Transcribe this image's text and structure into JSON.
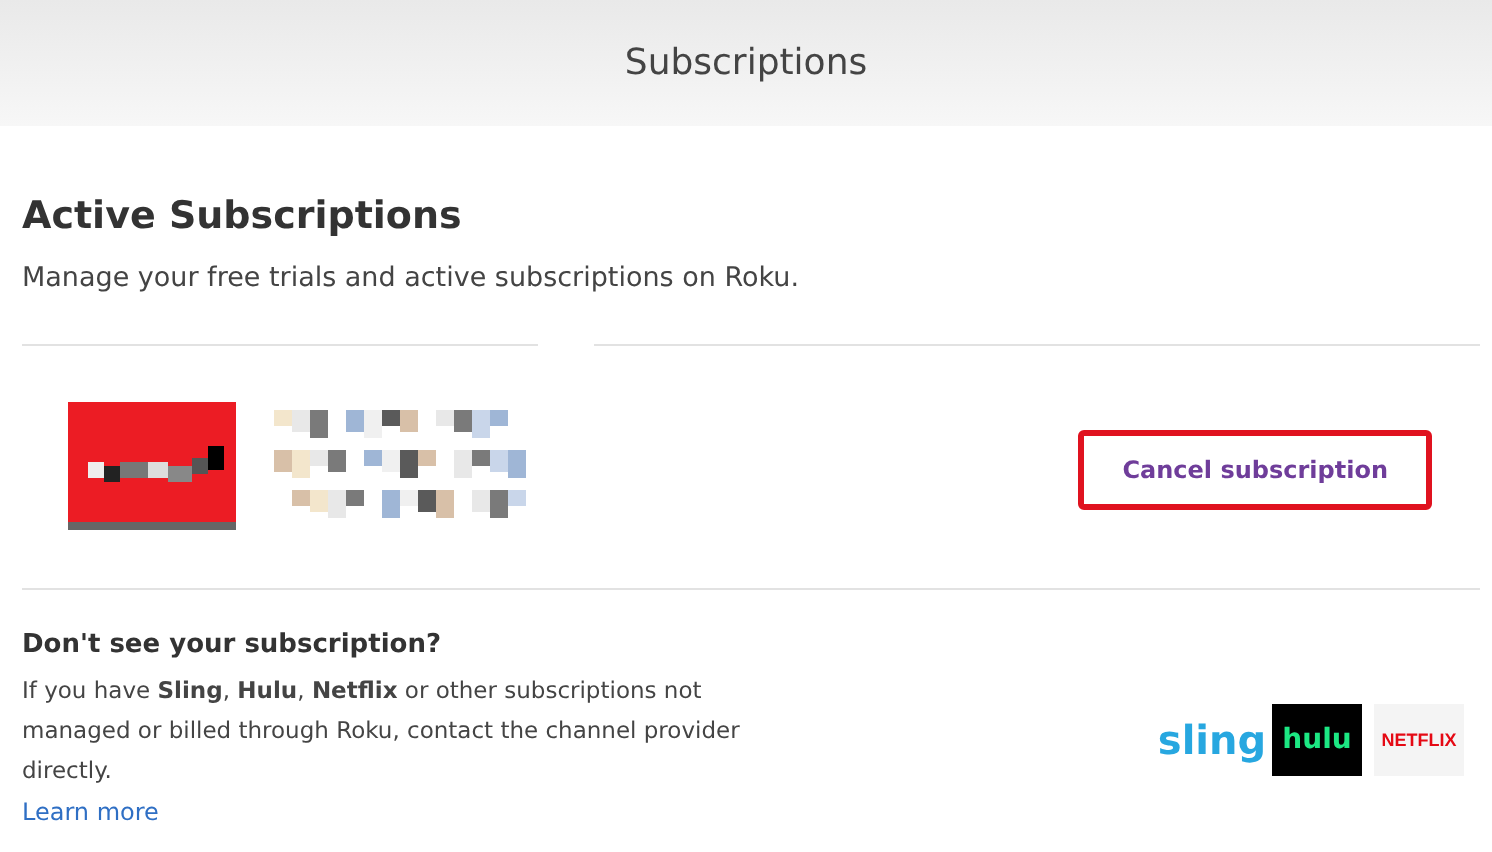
{
  "header": {
    "title": "Subscriptions"
  },
  "section": {
    "heading": "Active Subscriptions",
    "description": "Manage your free trials and active subscriptions on Roku."
  },
  "subscription": {
    "cancel_button": {
      "label": "Cancel subscription",
      "highlighted": true
    }
  },
  "help": {
    "heading": "Don't see your subscription?",
    "text": "If you have **Sling**, **Hulu**, **Netflix** or other subscriptions not managed or billed through Roku, contact the channel provider directly.",
    "link": "Learn more",
    "logos": [
      {
        "kind": "sling",
        "label": "sling"
      },
      {
        "kind": "hulu",
        "label": "hulu"
      },
      {
        "kind": "netflix",
        "label": "NETFLIX"
      }
    ]
  }
}
